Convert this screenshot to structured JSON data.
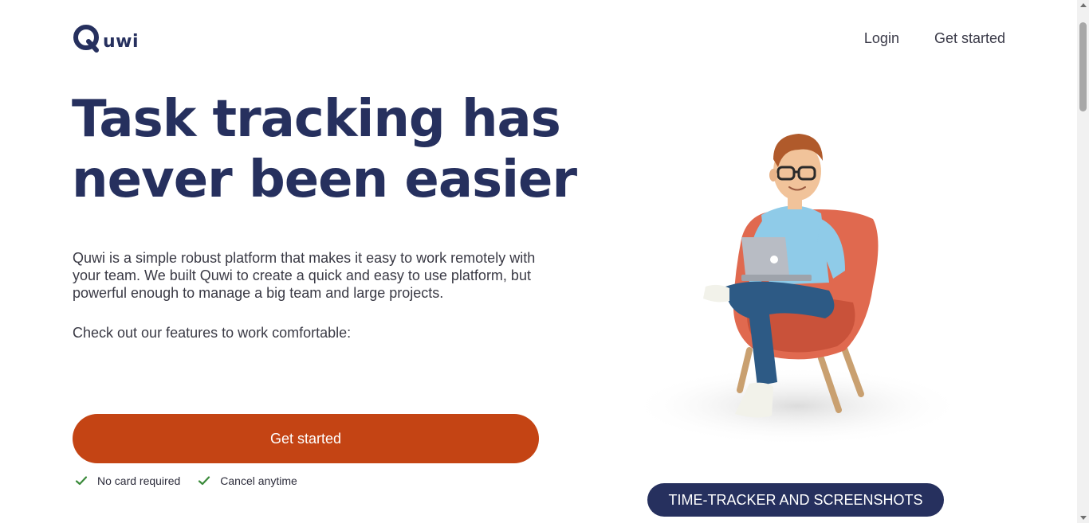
{
  "brand": {
    "name": "Quwi",
    "logo_text": "uwi"
  },
  "nav": {
    "login": "Login",
    "get_started": "Get started"
  },
  "hero": {
    "title": "Task tracking has never been easier",
    "description": "Quwi is a simple robust platform that makes it easy to work remotely with your team. We built Quwi to create a quick and easy to use platform, but powerful enough to manage a big team and large projects.",
    "features_intro": "Check out our features to work comfortable:",
    "cta_label": "Get started",
    "perks": [
      "No card required",
      "Cancel anytime"
    ]
  },
  "feature_pill": {
    "label": "TIME-TRACKER AND SCREENSHOTS"
  },
  "colors": {
    "brand_navy": "#26305e",
    "cta_orange": "#c44414",
    "check_green": "#3a8a3a",
    "chair_coral": "#e0694f",
    "shirt_blue": "#8fcbe8"
  },
  "icons": [
    "quwi-logo-icon",
    "check-icon",
    "person-on-chair-illustration"
  ]
}
